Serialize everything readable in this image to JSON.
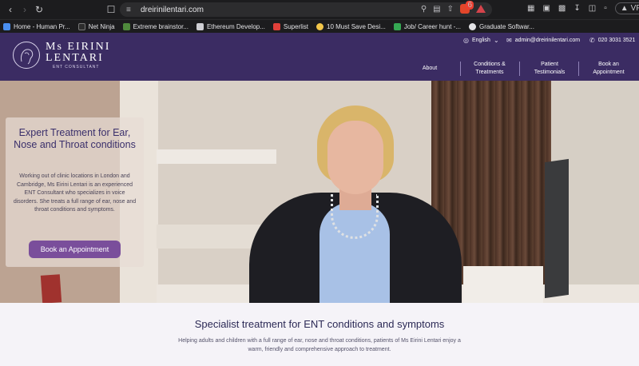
{
  "browser": {
    "url": "dreirinilentari.com",
    "brave_count": "6",
    "vpn_label": "VPN",
    "bookmarks": [
      {
        "label": "Home - Human Pr...",
        "color": "#4a8ff0"
      },
      {
        "label": "Net Ninja",
        "color": "#2d2d2d"
      },
      {
        "label": "Extreme brainstor...",
        "color": "#4f8a3c"
      },
      {
        "label": "Ethereum Develop...",
        "color": "#cfcfd4"
      },
      {
        "label": "Superlist",
        "color": "#e0403a"
      },
      {
        "label": "10 Must Save Desi...",
        "color": "#f2c64a"
      },
      {
        "label": "Job/ Career hunt -...",
        "color": "#35a853"
      },
      {
        "label": "Graduate Softwar...",
        "color": "#e3e3e6"
      }
    ]
  },
  "site": {
    "logo": {
      "line1": "Ms EIRINI",
      "line2": "LENTARI",
      "subtitle": "ENT CONSULTANT"
    },
    "utility": {
      "language": "English",
      "email": "admin@dreirinilentari.com",
      "phone": "020 3031 3521"
    },
    "nav": [
      {
        "label": "About"
      },
      {
        "label": "Conditions & Treatments"
      },
      {
        "label": "Patient Testimonials"
      },
      {
        "label": "Book an Appointment"
      }
    ],
    "colors": {
      "brand": "#3b2c63",
      "button": "#7a4e9b"
    }
  },
  "hero": {
    "title": "Expert Treatment for Ear, Nose and Throat conditions",
    "body": "Working out of clinic locations in London and Cambridge, Ms Eirini Lentari is an experienced ENT Consultant who specializes in voice disorders. She treats a full range of ear, nose and throat conditions and symptoms.",
    "cta": "Book an Appointment"
  },
  "intro": {
    "title": "Specialist treatment for ENT conditions and symptoms",
    "text": "Helping adults and children with a full range of ear, nose and throat conditions, patients of Ms Eirini Lentari enjoy a warm, friendly and comprehensive approach to treatment."
  }
}
